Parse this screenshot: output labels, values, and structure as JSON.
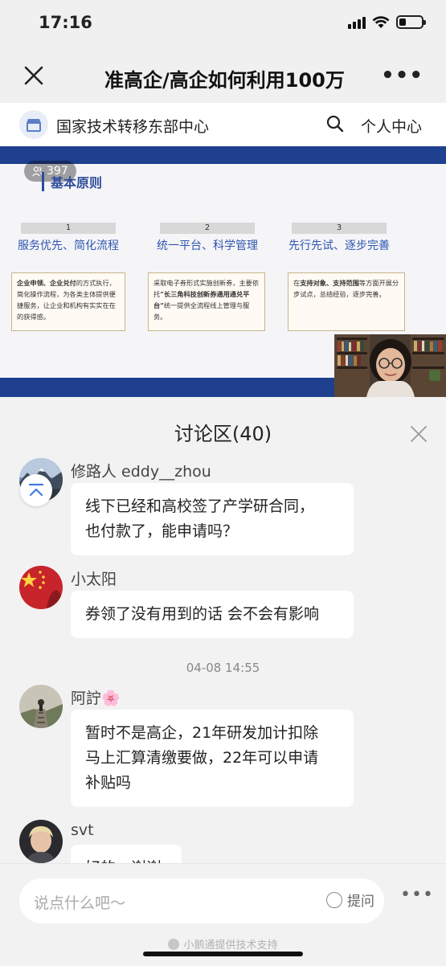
{
  "status_bar": {
    "time": "17:16"
  },
  "nav": {
    "title": "准高企/高企如何利用100万"
  },
  "org": {
    "name": "国家技术转移东部中心",
    "personal_center": "个人中心"
  },
  "video": {
    "viewer_count": "397",
    "slide": {
      "heading": "基本原则",
      "principles": [
        {
          "num": "1",
          "title": "服务优先、简化流程",
          "desc_bold": "企业申领、企业兑付",
          "desc": "的方式执行，简化操作流程，为各类主体提供便捷服务，让企业和机构有实实在在的获得感。"
        },
        {
          "num": "2",
          "title": "统一平台、科学管理",
          "desc_pre": "采取电子券形式实施创新券，主要依托",
          "desc_bold": "“长三角科技创新券通用通兑平台”",
          "desc": "统一提供全流程线上管理与服务。"
        },
        {
          "num": "3",
          "title": "先行先试、逐步完善",
          "desc_pre": "在",
          "desc_bold": "支持对象、支持范围",
          "desc": "等方面开展分步试点，总结经验，逐步完善。"
        }
      ]
    }
  },
  "discussion": {
    "title": "讨论区(40)",
    "messages": [
      {
        "name": "修路人 eddy__zhou",
        "line1": "线下已经和高校签了产学研合同，",
        "line2": "也付款了，能申请吗？"
      },
      {
        "name": "小太阳",
        "line1": "券领了没有用到的话 会不会有影响"
      },
      {
        "timestamp": "04-08 14:55"
      },
      {
        "name": "阿詝🌸",
        "line1": "暂时不是高企，21年研发加计扣除",
        "line2": "马上汇算清缴要做，22年可以申请",
        "line3": "补贴吗"
      },
      {
        "name": "svt",
        "line1": "好的，谢谢"
      }
    ]
  },
  "input": {
    "placeholder": "说点什么吧～",
    "ask_label": "提问"
  },
  "footer": {
    "tech_support": "小鹅通提供技术支持"
  }
}
